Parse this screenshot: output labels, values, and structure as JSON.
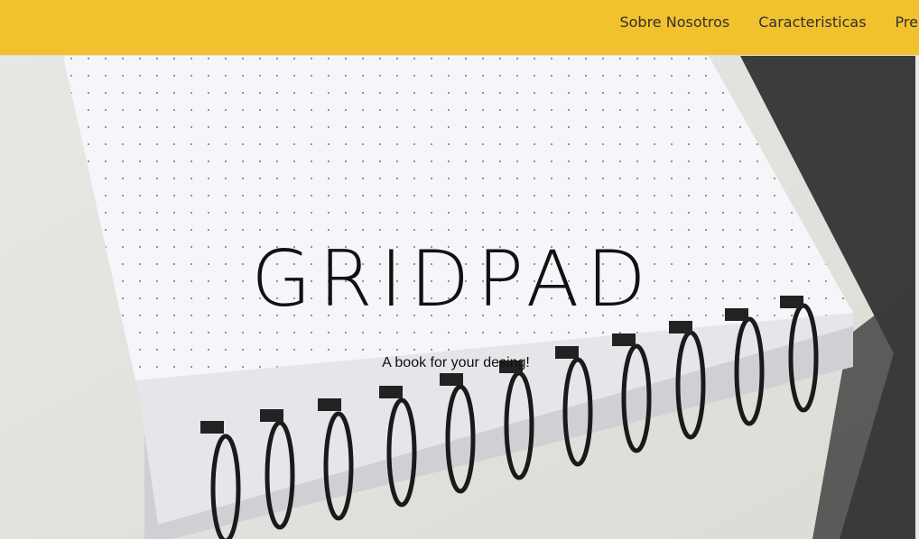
{
  "nav": {
    "items": [
      {
        "label": "Sobre Nosotros"
      },
      {
        "label": "Caracteristicas"
      },
      {
        "label": "Precio"
      }
    ]
  },
  "hero": {
    "title": "GRIDPAD",
    "subtitle": "A book for your desing!",
    "image_icon": "spiral-notebook-icon"
  },
  "colors": {
    "header_bg": "#f2c12e",
    "text": "#303030"
  }
}
